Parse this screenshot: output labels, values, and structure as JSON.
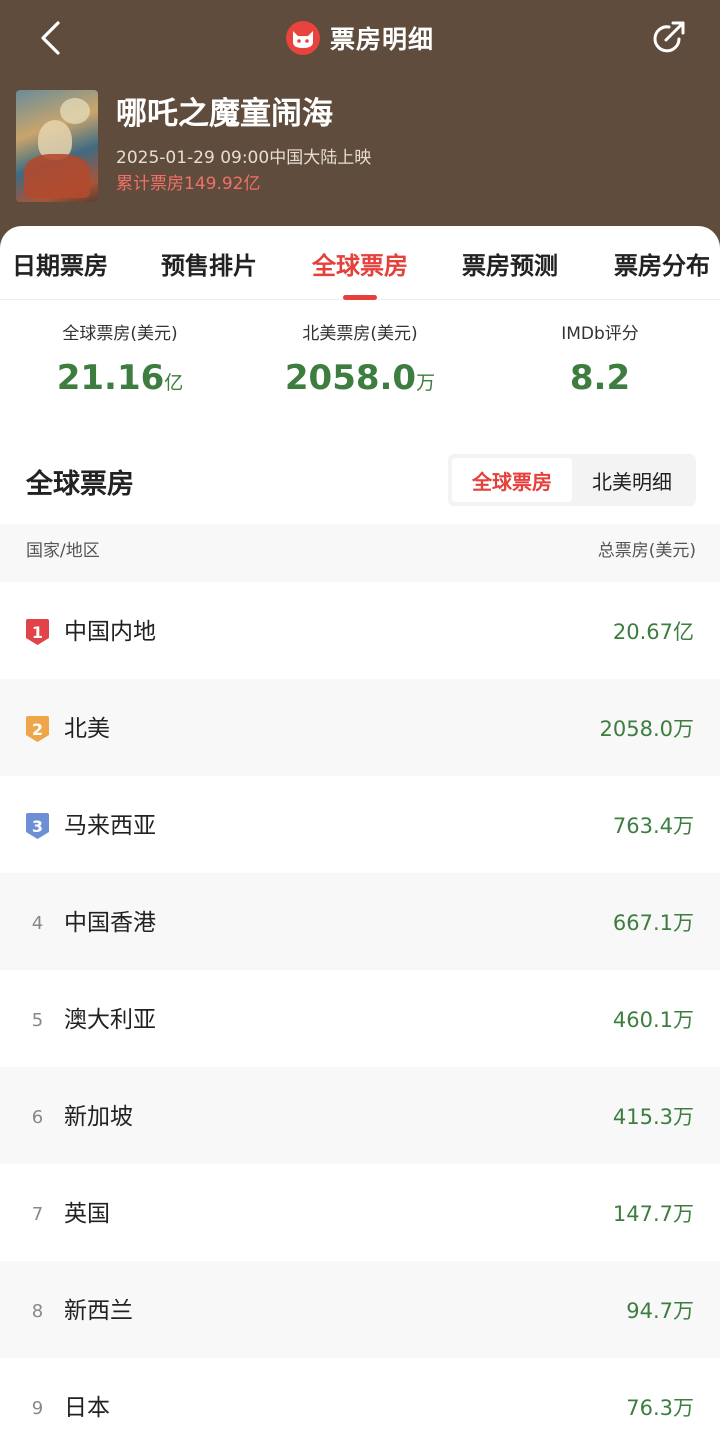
{
  "header": {
    "title": "票房明细",
    "movie": {
      "title": "哪吒之魔童闹海",
      "release": "2025-01-29 09:00中国大陆上映",
      "total": "累计票房149.92亿"
    }
  },
  "tabs": [
    {
      "label": "日期票房",
      "active": false
    },
    {
      "label": "预售排片",
      "active": false
    },
    {
      "label": "全球票房",
      "active": true
    },
    {
      "label": "票房预测",
      "active": false
    },
    {
      "label": "票房分布",
      "active": false
    }
  ],
  "stats": [
    {
      "label": "全球票房(美元)",
      "value": "21.16",
      "unit": "亿"
    },
    {
      "label": "北美票房(美元)",
      "value": "2058.0",
      "unit": "万"
    },
    {
      "label": "IMDb评分",
      "value": "8.2",
      "unit": ""
    }
  ],
  "section": {
    "title": "全球票房",
    "segments": [
      {
        "label": "全球票房",
        "active": true
      },
      {
        "label": "北美明细",
        "active": false
      }
    ]
  },
  "table": {
    "col_country": "国家/地区",
    "col_total": "总票房(美元)",
    "rows": [
      {
        "rank": "1",
        "country": "中国内地",
        "amount": "20.67亿"
      },
      {
        "rank": "2",
        "country": "北美",
        "amount": "2058.0万"
      },
      {
        "rank": "3",
        "country": "马来西亚",
        "amount": "763.4万"
      },
      {
        "rank": "4",
        "country": "中国香港",
        "amount": "667.1万"
      },
      {
        "rank": "5",
        "country": "澳大利亚",
        "amount": "460.1万"
      },
      {
        "rank": "6",
        "country": "新加坡",
        "amount": "415.3万"
      },
      {
        "rank": "7",
        "country": "英国",
        "amount": "147.7万"
      },
      {
        "rank": "8",
        "country": "新西兰",
        "amount": "94.7万"
      },
      {
        "rank": "9",
        "country": "日本",
        "amount": "76.3万"
      }
    ]
  },
  "colors": {
    "header_bg": "#5f4c3c",
    "accent": "#e5403b",
    "value_green": "#3d7d3f",
    "rank1": "#e0444a",
    "rank2": "#efa54a",
    "rank3": "#6e8fd6"
  },
  "icons": {
    "back": "back-arrow-icon",
    "logo": "cat-logo-icon",
    "share": "share-icon"
  }
}
